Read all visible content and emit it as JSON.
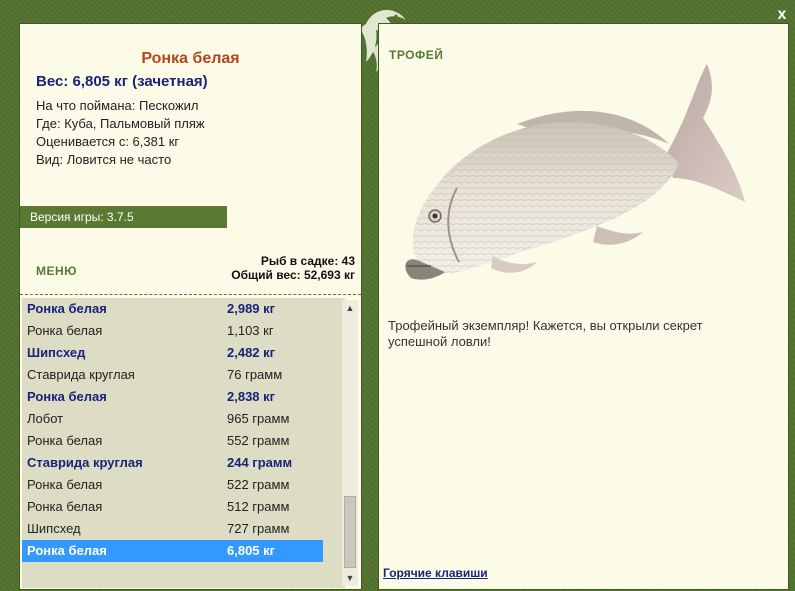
{
  "window": {
    "close_label": "x"
  },
  "fish": {
    "name": "Ронка белая",
    "weight": "Вес: 6,805 кг (зачетная)",
    "bait": "На что поймана: Пескожил",
    "location": "Где: Куба, Пальмовый пляж",
    "value": "Оценивается с: 6,381 кг",
    "species": "Вид: Ловится не часто"
  },
  "version": "Версия игры: 3.7.5",
  "menu_label": "МЕНЮ",
  "stats": {
    "count": "Рыб в садке: 43",
    "total_weight": "Общий вес: 52,693 кг"
  },
  "catch_list": [
    {
      "name": "Ронка белая",
      "weight": "2,989 кг",
      "bold": true
    },
    {
      "name": "Ронка белая",
      "weight": "1,103 кг",
      "bold": false
    },
    {
      "name": "Шипсхед",
      "weight": "2,482 кг",
      "bold": true
    },
    {
      "name": "Ставрида круглая",
      "weight": "76 грамм",
      "bold": false
    },
    {
      "name": "Ронка белая",
      "weight": "2,838 кг",
      "bold": true
    },
    {
      "name": "Лобот",
      "weight": "965 грамм",
      "bold": false
    },
    {
      "name": "Ронка белая",
      "weight": "552 грамм",
      "bold": false
    },
    {
      "name": "Ставрида круглая",
      "weight": "244 грамм",
      "bold": true
    },
    {
      "name": "Ронка белая",
      "weight": "522 грамм",
      "bold": false
    },
    {
      "name": "Ронка белая",
      "weight": "512 грамм",
      "bold": false
    },
    {
      "name": "Шипсхед",
      "weight": "727 грамм",
      "bold": false
    },
    {
      "name": "Ронка белая",
      "weight": "6,805 кг",
      "bold": true,
      "selected": true
    }
  ],
  "scrollbar": {
    "up_icon": "scroll-up-arrow-icon",
    "down_icon": "scroll-down-arrow-icon"
  },
  "trophy": {
    "label": "ТРОФЕЙ",
    "text": "Трофейный экземпляр! Кажется, вы открыли секрет успешной ловли!"
  },
  "hotkeys_label": "Горячие клавиши",
  "colors": {
    "frame": "#52722f",
    "panel": "#fbfbe8",
    "accent_green": "#5a7a34",
    "name_color": "#b4461a",
    "navy": "#1a237a",
    "selected": "#3399ff"
  }
}
